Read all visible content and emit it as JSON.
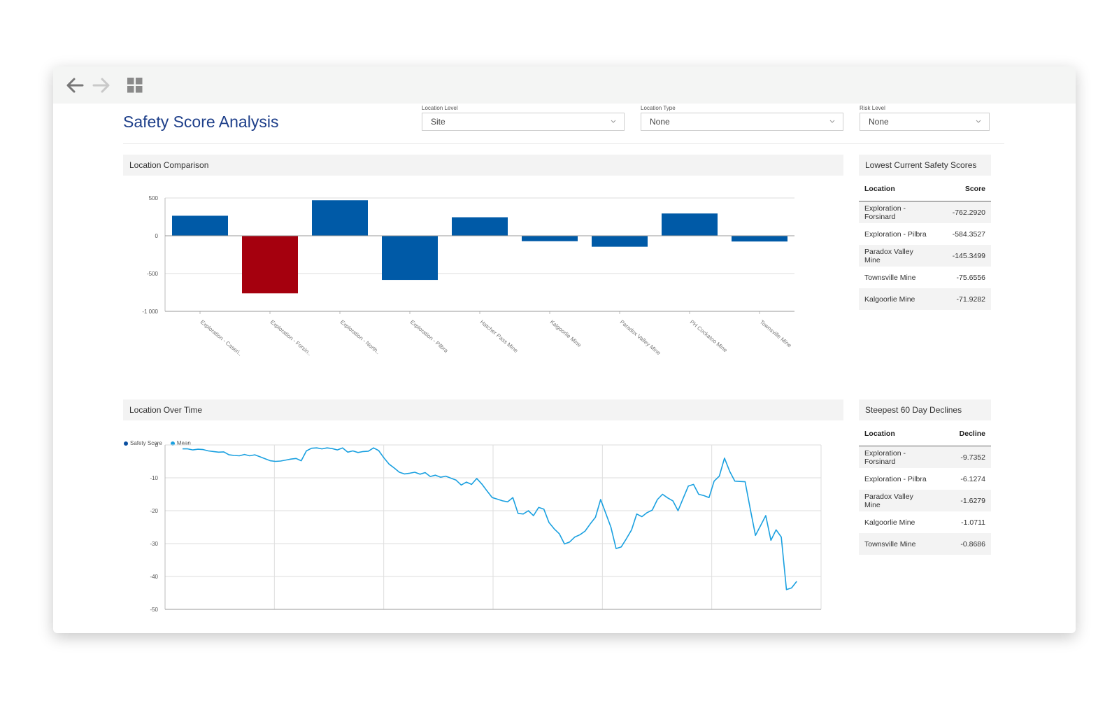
{
  "toolbar": {
    "back_icon": "arrow-left-icon",
    "forward_icon": "arrow-right-icon",
    "apps_icon": "grid-icon"
  },
  "page_title": "Safety Score Analysis",
  "filters": [
    {
      "label": "Location Level",
      "value": "Site"
    },
    {
      "label": "Location Type",
      "value": "None"
    },
    {
      "label": "Risk Level",
      "value": "None"
    }
  ],
  "location_comparison": {
    "title": "Location Comparison"
  },
  "location_over_time": {
    "title": "Location Over Time",
    "legend": [
      "Safety Score",
      "Mean"
    ]
  },
  "lowest_scores": {
    "title": "Lowest Current Safety Scores",
    "col_location": "Location",
    "col_value": "Score",
    "rows": [
      {
        "location": "Exploration - Forsinard",
        "value": "-762.2920"
      },
      {
        "location": "Exploration - Pilbra",
        "value": "-584.3527"
      },
      {
        "location": "Paradox Valley Mine",
        "value": "-145.3499"
      },
      {
        "location": "Townsville Mine",
        "value": "-75.6556"
      },
      {
        "location": "Kalgoorlie Mine",
        "value": "-71.9282"
      }
    ]
  },
  "steepest_declines": {
    "title": "Steepest 60 Day Declines",
    "col_location": "Location",
    "col_value": "Decline",
    "rows": [
      {
        "location": "Exploration - Forsinard",
        "value": "-9.7352"
      },
      {
        "location": "Exploration - Pilbra",
        "value": "-6.1274"
      },
      {
        "location": "Paradox Valley Mine",
        "value": "-1.6279"
      },
      {
        "location": "Kalgoorlie Mine",
        "value": "-1.0711"
      },
      {
        "location": "Townsville Mine",
        "value": "-0.8686"
      }
    ]
  },
  "colors": {
    "bar_blue": "#005aa7",
    "bar_red": "#a5000e",
    "line": "#1aa0e0",
    "safety_score": "#0a4fa0",
    "mean": "#1aa0e0",
    "title": "#1e3f8a"
  },
  "chart_data": [
    {
      "type": "bar",
      "categories": [
        "Exploration - Caseri..",
        "Exploration - Forsin..",
        "Exploration - North..",
        "Exploration - Pilbra",
        "Hatcher Pass Mine",
        "Kalgoorlie Mine",
        "Paradox Valley Mine",
        "PH Cockatoo Mine",
        "Townsville Mine"
      ],
      "values": [
        265,
        -762,
        470,
        -584,
        245,
        -72,
        -145,
        295,
        -76
      ],
      "highlight_index": 1,
      "ylim": [
        -1000,
        500
      ],
      "yticks": [
        "500",
        "0",
        "-500",
        "-1 000"
      ],
      "ytick_values": [
        500,
        0,
        -500,
        -1000
      ],
      "grid": true
    },
    {
      "type": "line",
      "ylim": [
        -50,
        0
      ],
      "yticks": [
        "0",
        "-10",
        "-20",
        "-30",
        "-40",
        "-50"
      ],
      "ytick_values": [
        0,
        -10,
        -20,
        -30,
        -40,
        -50
      ],
      "grid": true,
      "legend_position": "top-left",
      "x_index": [
        0,
        1,
        2,
        3,
        4,
        5,
        6,
        7,
        8,
        9,
        10,
        11,
        12,
        13,
        14,
        15,
        16,
        17,
        18,
        19,
        20,
        21,
        22,
        23,
        24,
        25,
        26,
        27,
        28,
        29,
        30,
        31,
        32,
        33,
        34,
        35,
        36,
        37,
        38,
        39,
        40,
        41,
        42,
        43,
        44,
        45,
        46,
        47,
        48,
        49,
        50,
        51,
        52,
        53,
        54,
        55,
        56,
        57,
        58,
        59,
        60,
        61,
        62,
        63,
        64,
        65,
        66,
        67,
        68,
        69,
        70,
        71,
        72,
        73,
        74,
        75,
        76,
        77,
        78,
        79,
        80,
        81,
        82,
        83,
        84,
        85,
        86,
        87,
        88,
        89,
        90,
        91,
        92,
        93,
        94,
        95,
        96,
        97,
        98,
        99,
        100,
        101,
        102,
        103,
        104,
        105,
        106,
        107,
        108,
        109,
        110,
        111,
        112,
        113,
        114,
        115,
        116,
        117,
        118,
        119
      ],
      "x_max": 120,
      "series": [
        {
          "name": "Mean",
          "values": [
            -1.2,
            -1.2,
            -1.5,
            -1.3,
            -1.4,
            -1.8,
            -2.0,
            -2.2,
            -2.1,
            -3.0,
            -3.2,
            -3.3,
            -2.9,
            -3.3,
            -3.0,
            -3.6,
            -4.2,
            -4.8,
            -5.0,
            -4.9,
            -4.6,
            -4.3,
            -4.1,
            -4.8,
            -1.8,
            -1.0,
            -0.9,
            -1.2,
            -0.9,
            -1.1,
            -1.5,
            -0.9,
            -2.2,
            -1.8,
            -2.3,
            -2.0,
            -1.9,
            -0.9,
            -1.7,
            -3.9,
            -5.8,
            -7.0,
            -8.3,
            -8.8,
            -8.6,
            -8.3,
            -8.9,
            -8.4,
            -9.6,
            -9.2,
            -9.8,
            -9.5,
            -10.1,
            -10.7,
            -12.2,
            -11.3,
            -12.0,
            -10.2,
            -11.9,
            -14.0,
            -16.0,
            -16.5,
            -17.0,
            -17.3,
            -16.0,
            -20.8,
            -21.0,
            -20.0,
            -21.5,
            -19.0,
            -19.5,
            -23.6,
            -25.5,
            -27.0,
            -30.1,
            -29.5,
            -28.0,
            -27.3,
            -26.2,
            -24.0,
            -22.0,
            -16.6,
            -20.8,
            -25.0,
            -31.5,
            -31.0,
            -28.5,
            -25.8,
            -21.0,
            -21.8,
            -20.6,
            -19.8,
            -16.6,
            -15.0,
            -16.1,
            -17.0,
            -20.0,
            -16.2,
            -12.5,
            -12.0,
            -15.0,
            -15.4,
            -16.0,
            -11.0,
            -9.5,
            -4.0,
            -8.0,
            -11.0,
            -11.1,
            -11.2,
            -19.5,
            -27.5,
            -24.5,
            -21.5,
            -29.0,
            -25.8,
            -28.0,
            -44.0,
            -43.5,
            -41.5
          ]
        }
      ]
    }
  ]
}
